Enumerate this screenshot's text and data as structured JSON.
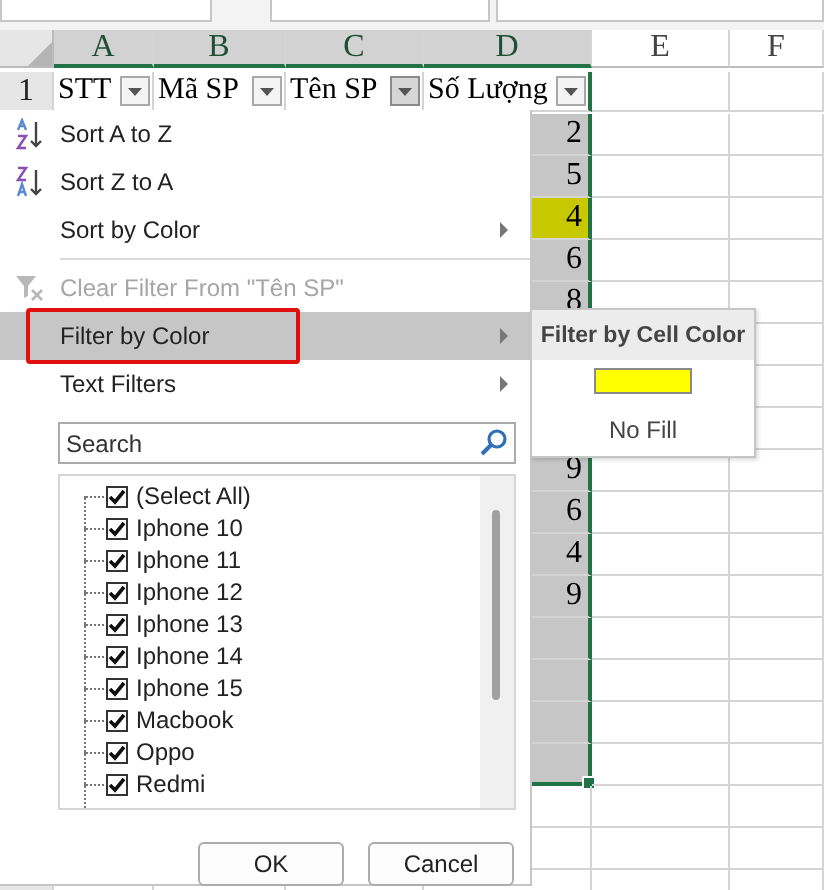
{
  "sheet": {
    "column_headers": [
      {
        "label": "A",
        "selected": true
      },
      {
        "label": "B",
        "selected": true
      },
      {
        "label": "C",
        "selected": true
      },
      {
        "label": "D",
        "selected": true
      },
      {
        "label": "E",
        "selected": false
      },
      {
        "label": "F",
        "selected": false
      }
    ],
    "row_headers": [
      "1"
    ],
    "header_row": [
      {
        "text": "STT",
        "filter_active": false
      },
      {
        "text": "Mã SP",
        "filter_active": false
      },
      {
        "text": "Tên SP",
        "filter_active": true
      },
      {
        "text": "Số Lượng",
        "filter_active": false
      }
    ],
    "column_d": [
      {
        "value": "2",
        "selected": true
      },
      {
        "value": "5",
        "selected": true
      },
      {
        "value": "4",
        "color": "#c8c800"
      },
      {
        "value": "6",
        "selected": true
      },
      {
        "value": "8",
        "selected": true
      }
    ],
    "column_d_lower": [
      {
        "value": "9",
        "selected": true
      },
      {
        "value": "6",
        "selected": true
      },
      {
        "value": "4",
        "selected": true
      },
      {
        "value": "9",
        "selected": true
      },
      {
        "selected": true
      },
      {
        "selected": true
      },
      {
        "selected": true
      },
      {
        "selected": true
      }
    ]
  },
  "filter_menu": {
    "items": [
      {
        "kind": "sort-ascending",
        "label": "Sort A to Z",
        "disabled": false,
        "highlighted": false,
        "submenu": false
      },
      {
        "kind": "sort-descending",
        "label": "Sort Z to A",
        "disabled": false,
        "highlighted": false,
        "submenu": false
      },
      {
        "kind": "plain",
        "label": "Sort by Color",
        "disabled": false,
        "highlighted": false,
        "submenu": true
      },
      {
        "kind": "separator"
      },
      {
        "kind": "clear-filter",
        "label": "Clear Filter From \"Tên SP\"",
        "disabled": true,
        "highlighted": false,
        "submenu": false
      },
      {
        "kind": "plain",
        "label": "Filter by Color",
        "disabled": false,
        "highlighted": true,
        "submenu": true,
        "annotated": true
      },
      {
        "kind": "plain",
        "label": "Text Filters",
        "disabled": false,
        "highlighted": false,
        "submenu": true
      }
    ],
    "search": {
      "placeholder": "Search"
    },
    "values": [
      {
        "label": "(Select All)",
        "checked": true
      },
      {
        "label": "Iphone 10",
        "checked": true
      },
      {
        "label": "Iphone 11",
        "checked": true
      },
      {
        "label": "Iphone 12",
        "checked": true
      },
      {
        "label": "Iphone 13",
        "checked": true
      },
      {
        "label": "Iphone 14",
        "checked": true
      },
      {
        "label": "Iphone 15",
        "checked": true
      },
      {
        "label": "Macbook",
        "checked": true
      },
      {
        "label": "Oppo",
        "checked": true
      },
      {
        "label": "Redmi",
        "checked": true
      }
    ],
    "buttons": [
      "OK",
      "Cancel"
    ]
  },
  "color_submenu": {
    "title": "Filter by Cell Color",
    "colors": [
      {
        "color": "#ffff00"
      }
    ],
    "no_fill": "No Fill"
  }
}
